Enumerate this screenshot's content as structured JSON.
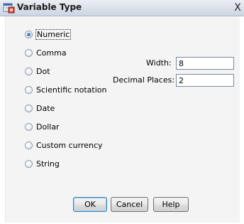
{
  "window": {
    "title": "Variable Type",
    "close_glyph": "X",
    "icon": "spss-variable-type-icon"
  },
  "types": [
    {
      "label": "Numeric",
      "selected": true
    },
    {
      "label": "Comma",
      "selected": false
    },
    {
      "label": "Dot",
      "selected": false
    },
    {
      "label": "Scientific notation",
      "selected": false
    },
    {
      "label": "Date",
      "selected": false
    },
    {
      "label": "Dollar",
      "selected": false
    },
    {
      "label": "Custom currency",
      "selected": false
    },
    {
      "label": "String",
      "selected": false
    }
  ],
  "width": {
    "label": "Width:",
    "value": "8"
  },
  "decimal_places": {
    "label": "Decimal Places:",
    "value": "2"
  },
  "buttons": {
    "ok": "OK",
    "cancel": "Cancel",
    "help": "Help"
  },
  "colors": {
    "titlebar": "#dde3ec",
    "dialog_background": "#f4f4f4",
    "radio_selected": "#1b5bb5",
    "default_button_border": "#3c7fb1"
  }
}
